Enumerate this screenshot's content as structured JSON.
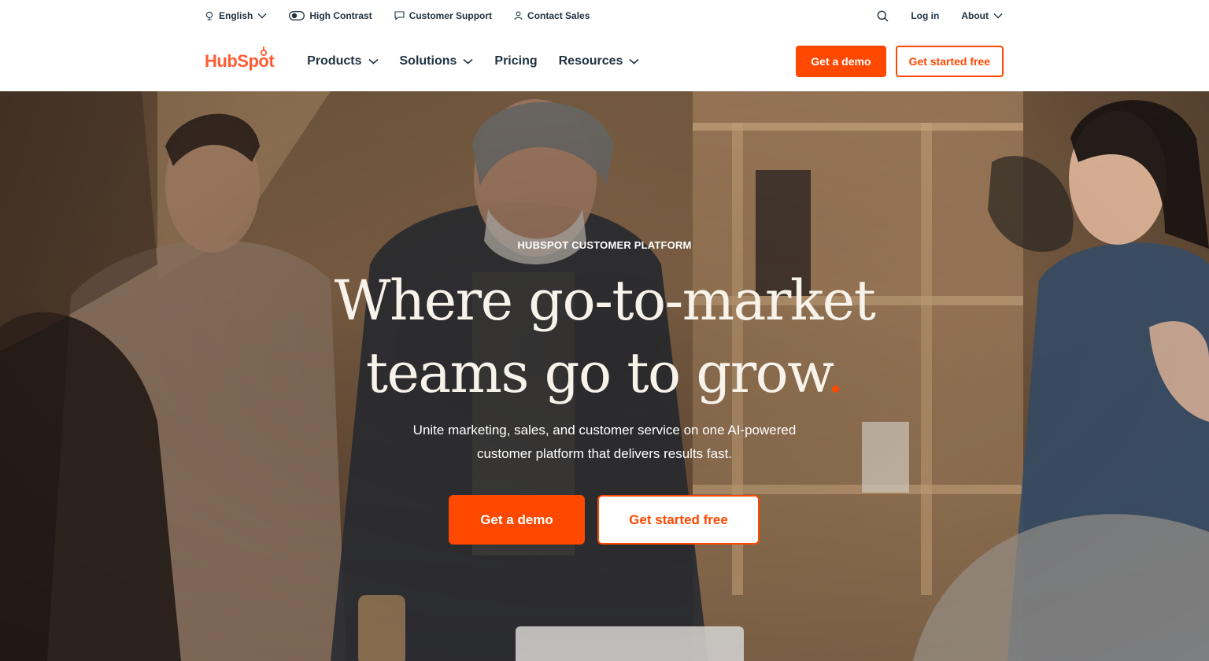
{
  "utility": {
    "language": "English",
    "high_contrast": "High Contrast",
    "support": "Customer Support",
    "contact_sales": "Contact Sales",
    "login": "Log in",
    "about": "About"
  },
  "brand": {
    "logo_text": "HubSpot",
    "accent_color": "#ff4800"
  },
  "nav": {
    "items": [
      {
        "label": "Products",
        "has_dropdown": true
      },
      {
        "label": "Solutions",
        "has_dropdown": true
      },
      {
        "label": "Pricing",
        "has_dropdown": false
      },
      {
        "label": "Resources",
        "has_dropdown": true
      }
    ],
    "demo_label": "Get a demo",
    "free_label": "Get started free"
  },
  "hero": {
    "eyebrow": "HUBSPOT CUSTOMER PLATFORM",
    "headline_line1": "Where go-to-market",
    "headline_line2": "teams go to grow",
    "headline_dot": ".",
    "subhead": "Unite marketing, sales, and customer service on one AI-powered customer platform that delivers results fast.",
    "demo_label": "Get a demo",
    "free_label": "Get started free"
  },
  "icons": {
    "language": "globe-icon",
    "high_contrast": "contrast-toggle-icon",
    "support": "chat-bubble-icon",
    "contact_sales": "person-icon",
    "search": "search-icon",
    "dropdown": "chevron-down-icon"
  }
}
